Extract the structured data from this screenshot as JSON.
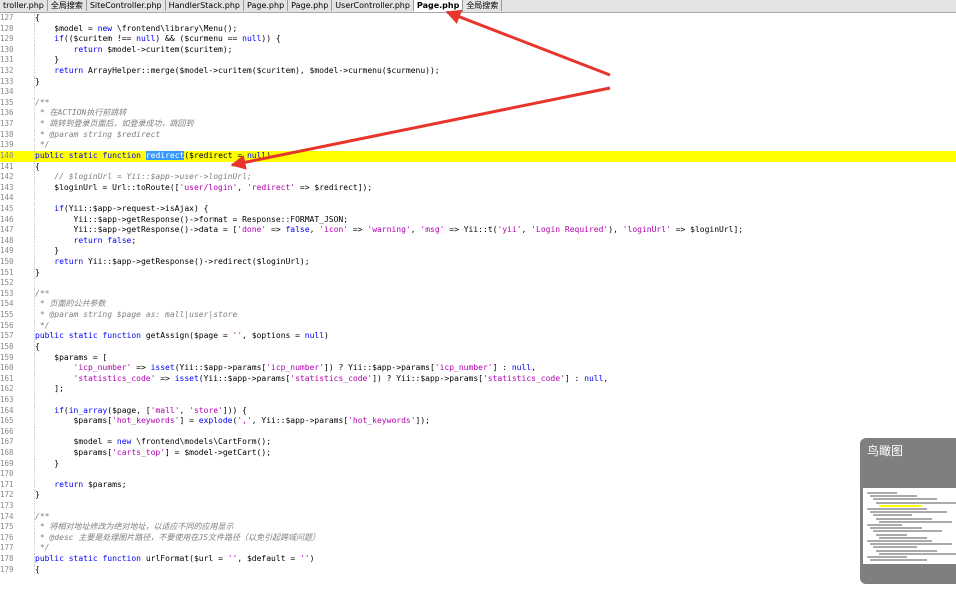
{
  "tabs": [
    {
      "label": "troller.php",
      "active": false
    },
    {
      "label": "全局搜索",
      "active": false
    },
    {
      "label": "SiteController.php",
      "active": false
    },
    {
      "label": "HandlerStack.php",
      "active": false
    },
    {
      "label": "Page.php",
      "active": false
    },
    {
      "label": "Page.php",
      "active": false
    },
    {
      "label": "UserController.php",
      "active": false
    },
    {
      "label": "Page.php",
      "active": true
    },
    {
      "label": "全局搜索",
      "active": false
    }
  ],
  "editor": {
    "highlight_color": "#ffff00",
    "selected_word": "redirect",
    "lines": [
      {
        "n": "127",
        "code": "{"
      },
      {
        "n": "128",
        "code": "    $model = new \\frontend\\library\\Menu();"
      },
      {
        "n": "129",
        "code": "    if(($curitem !== null) && ($curmenu == null)) {"
      },
      {
        "n": "130",
        "code": "        return $model->curitem($curitem);"
      },
      {
        "n": "131",
        "code": "    }"
      },
      {
        "n": "132",
        "code": "    return ArrayHelper::merge($model->curitem($curitem), $model->curmenu($curmenu));"
      },
      {
        "n": "133",
        "code": "}"
      },
      {
        "n": "134",
        "code": ""
      },
      {
        "n": "135",
        "code": "/**"
      },
      {
        "n": "136",
        "code": " * 在ACTION执行前跳转"
      },
      {
        "n": "137",
        "code": " * 跳转到登录页面后，如登录成功，跳回到"
      },
      {
        "n": "138",
        "code": " * @param string $redirect"
      },
      {
        "n": "139",
        "code": " */"
      },
      {
        "n": "140",
        "code": "public static function redirect($redirect = null)",
        "highlight": true
      },
      {
        "n": "141",
        "code": "{"
      },
      {
        "n": "142",
        "code": "    // $loginUrl = Yii::$app->user->loginUrl;"
      },
      {
        "n": "143",
        "code": "    $loginUrl = Url::toRoute(['user/login', 'redirect' => $redirect]);"
      },
      {
        "n": "144",
        "code": ""
      },
      {
        "n": "145",
        "code": "    if(Yii::$app->request->isAjax) {"
      },
      {
        "n": "146",
        "code": "        Yii::$app->getResponse()->format = Response::FORMAT_JSON;"
      },
      {
        "n": "147",
        "code": "        Yii::$app->getResponse()->data = ['done' => false, 'icon' => 'warning', 'msg' => Yii::t('yii', 'Login Required'), 'loginUrl' => $loginUrl];"
      },
      {
        "n": "148",
        "code": "        return false;"
      },
      {
        "n": "149",
        "code": "    }"
      },
      {
        "n": "150",
        "code": "    return Yii::$app->getResponse()->redirect($loginUrl);"
      },
      {
        "n": "151",
        "code": "}"
      },
      {
        "n": "152",
        "code": ""
      },
      {
        "n": "153",
        "code": "/**"
      },
      {
        "n": "154",
        "code": " * 页面的公共参数"
      },
      {
        "n": "155",
        "code": " * @param string $page as: mall|user|store"
      },
      {
        "n": "156",
        "code": " */"
      },
      {
        "n": "157",
        "code": "public static function getAssign($page = '', $options = null)"
      },
      {
        "n": "158",
        "code": "{"
      },
      {
        "n": "159",
        "code": "    $params = ["
      },
      {
        "n": "160",
        "code": "        'icp_number' => isset(Yii::$app->params['icp_number']) ? Yii::$app->params['icp_number'] : null,"
      },
      {
        "n": "161",
        "code": "        'statistics_code' => isset(Yii::$app->params['statistics_code']) ? Yii::$app->params['statistics_code'] : null,"
      },
      {
        "n": "162",
        "code": "    ];"
      },
      {
        "n": "163",
        "code": ""
      },
      {
        "n": "164",
        "code": "    if(in_array($page, ['mall', 'store'])) {"
      },
      {
        "n": "165",
        "code": "        $params['hot_keywords'] = explode(',', Yii::$app->params['hot_keywords']);"
      },
      {
        "n": "166",
        "code": ""
      },
      {
        "n": "167",
        "code": "        $model = new \\frontend\\models\\CartForm();"
      },
      {
        "n": "168",
        "code": "        $params['carts_top'] = $model->getCart();"
      },
      {
        "n": "169",
        "code": "    }"
      },
      {
        "n": "170",
        "code": ""
      },
      {
        "n": "171",
        "code": "    return $params;"
      },
      {
        "n": "172",
        "code": "}"
      },
      {
        "n": "173",
        "code": ""
      },
      {
        "n": "174",
        "code": "/**"
      },
      {
        "n": "175",
        "code": " * 将相对地址修改为绝对地址，以适应不同的应用显示"
      },
      {
        "n": "176",
        "code": " * @desc 主要是处理图片路径，不要使用在JS文件路径（以免引起跨域问题）"
      },
      {
        "n": "177",
        "code": " */"
      },
      {
        "n": "178",
        "code": "public static function urlFormat($url = '', $default = '')"
      },
      {
        "n": "179",
        "code": "{"
      }
    ]
  },
  "birdview": {
    "title": "鸟瞰图"
  },
  "colors": {
    "arrow": "#e8352b",
    "selection": "#3399ff",
    "line_highlight": "#ffff00"
  }
}
